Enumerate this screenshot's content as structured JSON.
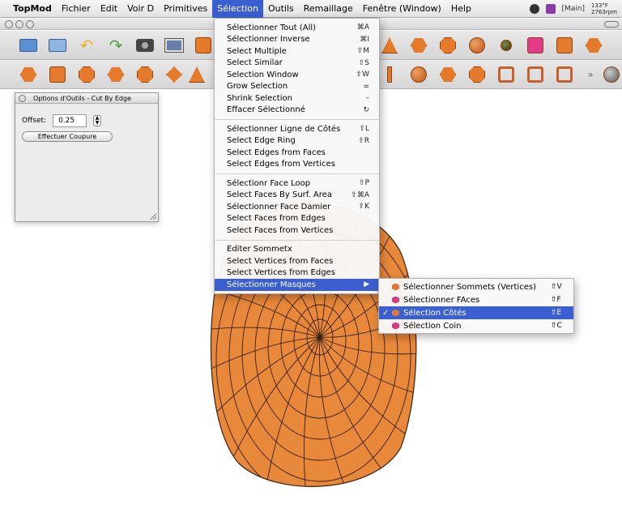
{
  "menubar": {
    "app": "TopMod",
    "items": [
      "Fichier",
      "Edit",
      "Voir D",
      "Primitives",
      "Sélection",
      "Outils",
      "Remaillage",
      "Fenêtre (Window)",
      "Help"
    ],
    "active_index": 4,
    "status": {
      "main_label": "[Main]",
      "temp": "133°F",
      "rpm": "2763rpm"
    }
  },
  "panel": {
    "title": "Options d'Outils - Cut By Edge",
    "offset_label": "Offset:",
    "offset_value": "0.25",
    "cut_button": "Effectuer Coupure"
  },
  "selection_menu": {
    "groups": [
      [
        {
          "label": "Sélectionner Tout (All)",
          "shortcut": "⌘A"
        },
        {
          "label": "Sélectionner Inverse",
          "shortcut": "⌘I"
        },
        {
          "label": "Select Multiple",
          "shortcut": "⇧M"
        },
        {
          "label": "Select Similar",
          "shortcut": "⇧S"
        },
        {
          "label": "Selection Window",
          "shortcut": "⇧W"
        },
        {
          "label": "Grow Selection",
          "shortcut": "="
        },
        {
          "label": "Shrink Selection",
          "shortcut": "–"
        },
        {
          "label": "Effacer Sélectionné",
          "shortcut": "↻"
        }
      ],
      [
        {
          "label": "Sélectionner Ligne de Côtés",
          "shortcut": "⇧L"
        },
        {
          "label": "Select Edge Ring",
          "shortcut": "⇧R"
        },
        {
          "label": "Select Edges from Faces",
          "shortcut": ""
        },
        {
          "label": "Select Edges from Vertices",
          "shortcut": ""
        }
      ],
      [
        {
          "label": "Sélectionr Face Loop",
          "shortcut": "⇧P"
        },
        {
          "label": "Select Faces By Surf. Area",
          "shortcut": "⇧⌘A"
        },
        {
          "label": "Sélectionner Face Damier",
          "shortcut": "⇧K"
        },
        {
          "label": "Select Faces from Edges",
          "shortcut": ""
        },
        {
          "label": "Select Faces from Vertices",
          "shortcut": ""
        }
      ],
      [
        {
          "label": "Editer Sommetx",
          "shortcut": ""
        },
        {
          "label": "Select Vertices from Faces",
          "shortcut": ""
        },
        {
          "label": "Select Vertices from Edges",
          "shortcut": ""
        },
        {
          "label": "Sélectionner Masques",
          "shortcut": "▶",
          "highlighted": true
        }
      ]
    ]
  },
  "masks_submenu": {
    "items": [
      {
        "label": "Sélectionner Sommets (Vertices)",
        "shortcut": "⇧V",
        "checked": false,
        "color": "#d9793a"
      },
      {
        "label": "Sélectionner FAces",
        "shortcut": "⇧F",
        "checked": false,
        "color": "#d83c7f"
      },
      {
        "label": "Sélection Côtés",
        "shortcut": "⇧E",
        "checked": true,
        "color": "#d9793a",
        "highlighted": true
      },
      {
        "label": "Sélection Coin",
        "shortcut": "⇧C",
        "checked": false,
        "color": "#d83c7f"
      }
    ]
  },
  "colors": {
    "accent": "#3b5fd0",
    "mesh": "#e8883a",
    "mesh_edge": "#3a2010"
  }
}
